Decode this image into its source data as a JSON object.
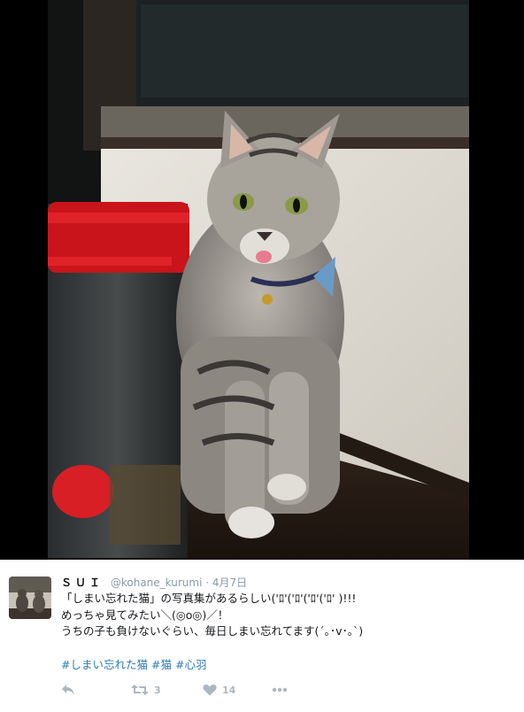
{
  "tweet": {
    "name": "ＳＵＩ",
    "handle": "@kohane_kurumi",
    "separator": "·",
    "date": "4月7日",
    "lines": [
      "「しまい忘れた猫」の写真集があるらしい('ﾛ'('ﾛ'('ﾛ'('ﾛ' )!!!",
      "めっちゃ見てみたい＼(◎o◎)／！",
      "うちの子も負けないぐらい、毎日しまい忘れてます(´｡･v･｡`)"
    ],
    "hashtags": [
      "#しまい忘れた猫",
      "#猫",
      "#心羽"
    ]
  },
  "actions": {
    "reply_icon": "reply-icon",
    "retweet_icon": "retweet-icon",
    "retweet_count": "3",
    "like_icon": "heart-icon",
    "like_count": "14",
    "more_icon": "more-icon"
  },
  "colors": {
    "link": "#2b7bb9",
    "muted": "#8899a6",
    "icon": "#aab8c2"
  }
}
